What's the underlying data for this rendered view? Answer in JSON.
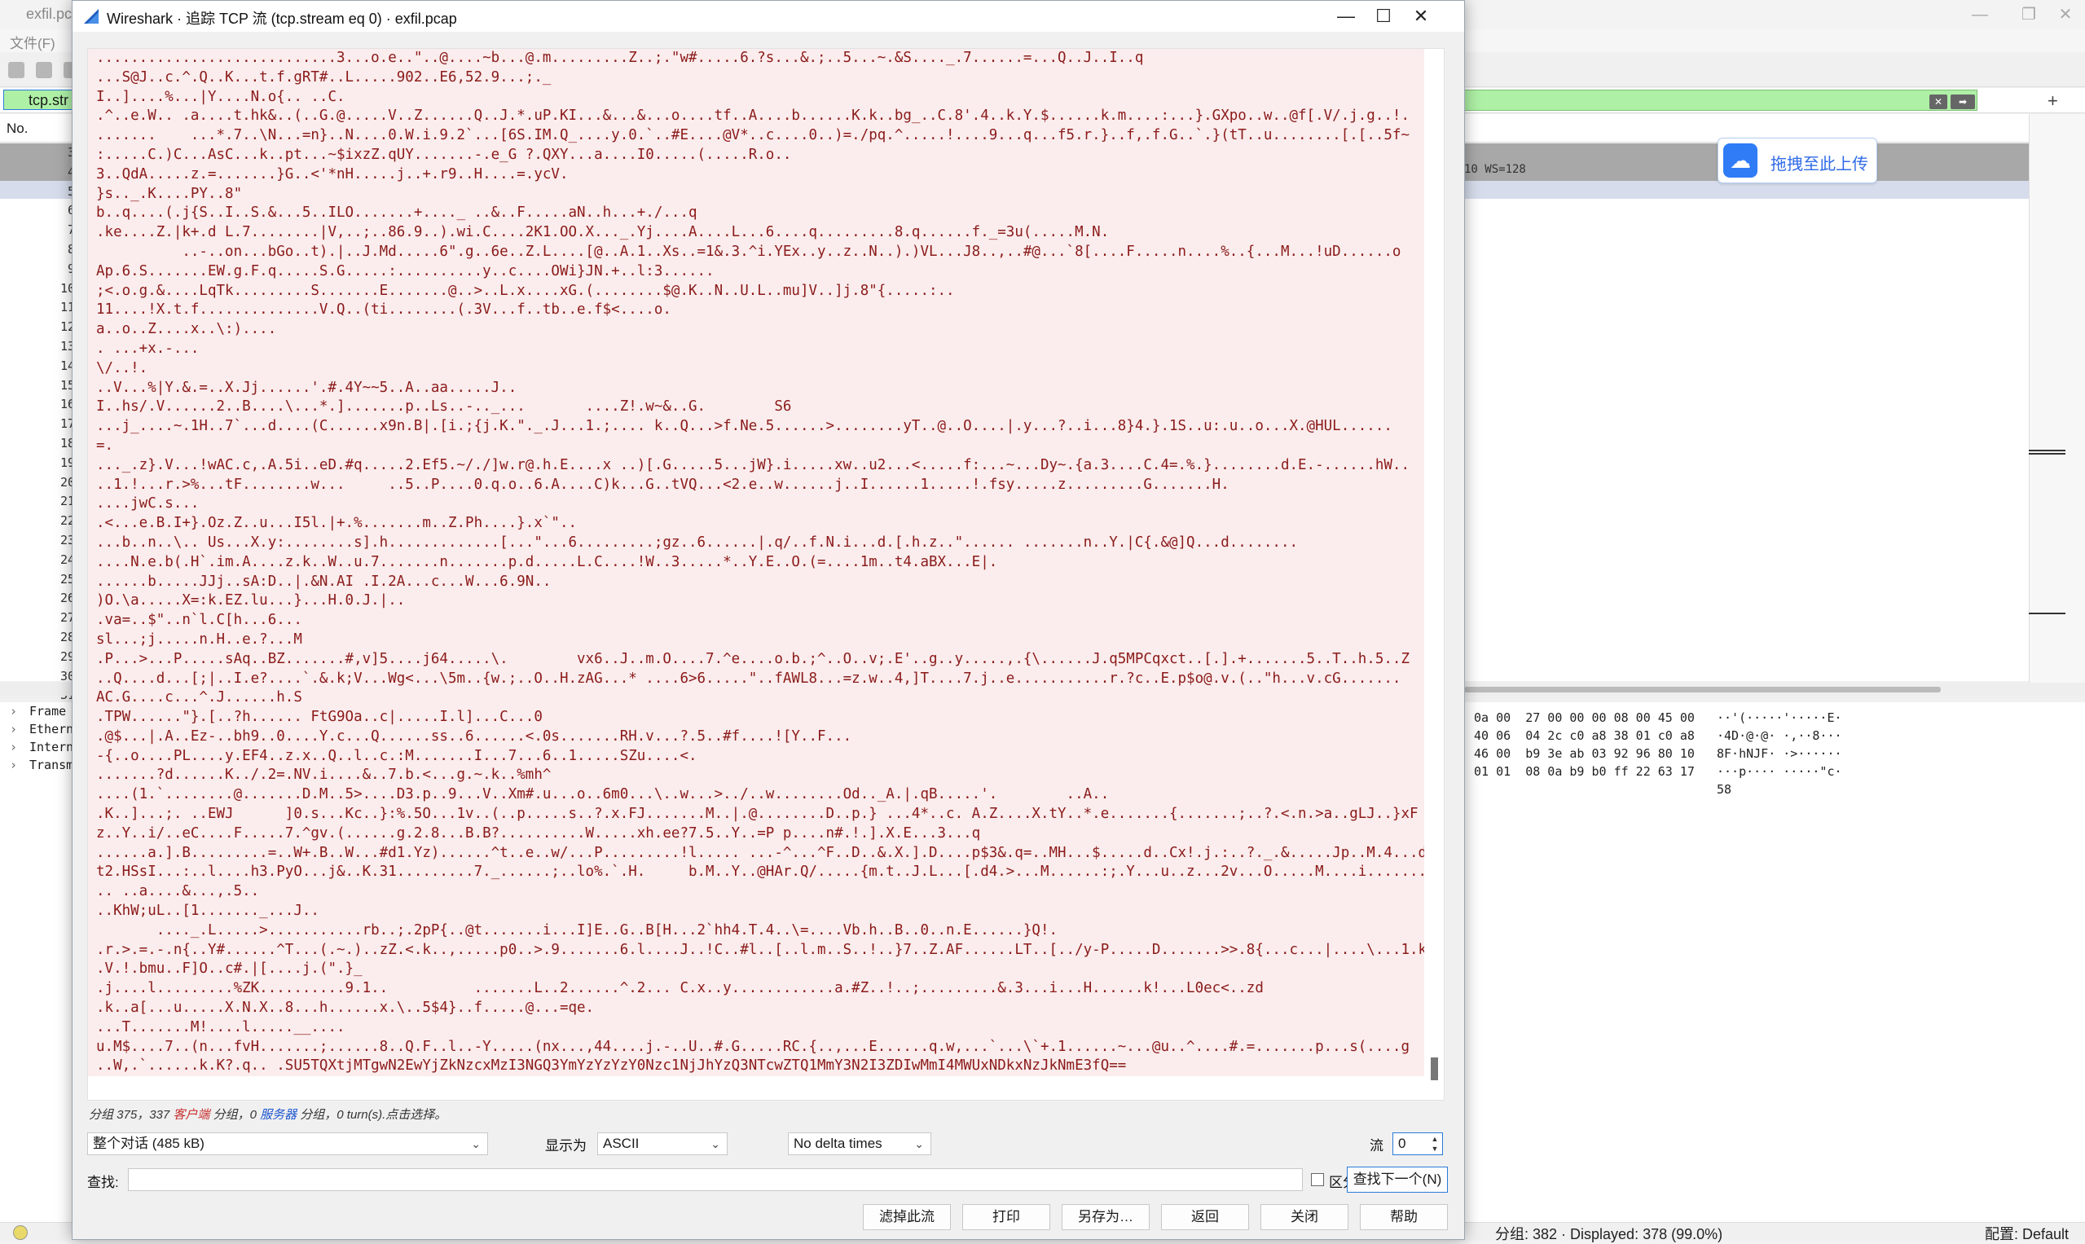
{
  "background_window": {
    "title": "exfil.pca",
    "menu_file": "文件(F)",
    "filter_text": "tcp.str",
    "col_no": "No.",
    "row_numbers": [
      "3",
      "4",
      "5",
      "6",
      "7",
      "8",
      "9",
      "10",
      "11",
      "12",
      "13",
      "14",
      "15",
      "16",
      "17",
      "18",
      "19",
      "20",
      "21",
      "22",
      "23",
      "24",
      "25",
      "26",
      "27",
      "28",
      "29",
      "30",
      "31"
    ],
    "row_info": "10 WS=128",
    "details": [
      "Frame",
      "Ethern",
      "Intern",
      "Transm"
    ],
    "bytes_hex": "0a 00  27 00 00 00 08 00 45 00\n40 06  04 2c c0 a8 38 01 c0 a8\n46 00  b9 3e ab 03 92 96 80 10\n01 01  08 0a b9 b0 ff 22 63 17",
    "bytes_ascii": "··'(·····'·····E·\n·4D·@·@· ·,··8···\n8F·hNJF· ·>······\n···p···· ·····\"c·\n58",
    "status_text": "分组: 382 · Displayed: 378 (99.0%)",
    "status_profile": "配置: Default",
    "upload_label": "拖拽至此上传"
  },
  "dialog": {
    "title": "Wireshark · 追踪 TCP 流 (tcp.stream eq 0) · exfil.pcap",
    "stream_lines": [
      "............................3...o.e..\"..@....~b...@.m.........Z..;.\"w#.....6.?s...&.;..5...~.&S...._.7......=...Q..J..I..q",
      "...S@J..c.^.Q..K...t.f.gRT#..L.....902..E6,52.9...;._",
      "I..]....%...|Y....N.o{.. ..C.",
      ".^..e.W.. .a....t.hk&..(..G.@.....V..Z......Q..J.*.uP.KI...&...&...o....tf..A....b......K.k..bg_..C.8'.4..k.Y.$......k.m....:...}.GXpo..w..@f[.V/.j.g..!.",
      ".......    ...*.7..\\N...=n}..N....0.W.i.9.2`...[6S.IM.Q_....y.0.`..#E....@V*..c....0..)=./pq.^.....!....9...q...f5.r.}..f,.f.G..`.}(tT..u........[.[..5f~",
      ":.....C.)C...AsC...k..pt...~$ixzZ.qUY.......-.e_G ?.QXY...a....I0.....(.....R.o..",
      "3..QdA.....z.=.......}G..<'*nH.....j..+.r9..H....=.ycV.",
      "}s.._.K....PY..8\"",
      "b..q....(.j{S..I..S.&...5..ILO.......+...._ ..&..F.....aN..h...+./...q",
      ".ke....Z.|k+.d L.7........|V,..;..86.9..).wi.C....2K1.OO.X..._.Yj....A....L...6....q.........8.q......f._=3u(.....M.N.",
      "          ..-..on...bGo..t).|..J.Md.....6\".g..6e..Z.L....[@..A.1..Xs..=1&.3.^i.YEx..y..z..N..).)VL...J8..,..#@...`8[....F.....n....%..{...M...!uD......o",
      "Ap.6.S.......EW.g.F.q.....S.G.....:..........y..c....OWi}JN.+..l:3......",
      ";<.o.g.&....LqTk.........S.......E.......@..>..L.x....xG.(........$@.K..N..U.L..mu]V..]j.8\"{.....:..",
      "11....!X.t.f..............V.Q..(ti........(.3V...f..tb..e.f$<....o.",
      "a..o..Z....x..\\:)....",
      ". ...+x.-...",
      "\\/..!.",
      "..V...%|Y.&.=..X.Jj......'.#.4Y~~5..A..aa.....J..",
      "I..hs/.V......2..B....\\...*.].......p..Ls..-.._...       ....Z!.w~&..G.        S6",
      "...j_....~.1H..7`...d....(C......x9n.B|.[i.;{j.K.\"._.J...1.;.... k..Q...>f.Ne.5......>........yT..@..O....|.y...?..i...8}4.}.1S..u:.u..o...X.@HUL......",
      "=.",
      "..._.z}.V...!wAC.c,.A.5i..eD.#q.....2.Ef5.~/./]w.r@.h.E....x ..)[.G.....5...jW}.i.....xw..u2...<.....f:...~...Dy~.{a.3....C.4=.%.}........d.E.-......hW..",
      "..1.!...r.>%...tF........w...     ..5..P....0.q.o..6.A....C)k...G..tVQ...<2.e..w......j..I......1.....!.fsy.....z.........G.......H.",
      "....jwC.s...",
      ".<...e.B.I+}.Oz.Z..u...I5l.|+.%.......m..Z.Ph....}.x`\"..",
      "...b..n..\\.. Us...X.y:........s].h.............[...\"...6.........;gz..6......|.q/..f.N.i...d.[.h.z..\"...... .......n..Y.|C{.&@]Q...d........",
      "....N.e.b(.H`.im.A....z.k..W..u.7.......n.......p.d.....L.C....!W..3.....*..Y.E..O.(=....1m..t4.aBX...E|.",
      "......b.....JJj..sA:D..|.&N.AI .I.2A...c...W...6.9N..",
      ")O.\\a.....X=:k.EZ.lu...}...H.0.J.|..",
      ".va=..$\"..n`l.C[h...6...",
      "sl...;j.....n.H..e.?...M",
      ".P...>...P.....sAq..BZ.......#,v]5....j64.....\\.        vx6..J..m.O....7.^e....o.b.;^..O..v;.E'..g..y.....,.{\\......J.q5MPCqxct..[.].+.......5..T..h.5..Z",
      "..Q....d...[;|..I.e?....`.&.k;V...Wg<...\\5m..{w.;..O..H.zAG...* ....6>6.....\"..fAWL8...=z.w..4,]T....7.j..e...........r.?c..E.p$o@.v.(..\"h...v.cG.......",
      "AC.G....c...^.J......h.S",
      ".TPW......\"}.[..?h...... FtG9Oa..c|.....I.l]...C...0",
      ".@$...|.A..Ez-..bh9..0....Y.c...Q......ss..6......<.0s.......RH.v...?.5..#f....![Y..F...",
      "-{..o....PL....y.EF4..z.x..Q..l..c.:M.......I...7...6..1.....SZu....<.",
      ".......?d......K../.2=.NV.i....&..7.b.<...g.~.k..%mh^",
      "....(1.`........@.......D.M..5>....D3.p..9...V..Xm#.u...o..6m0...\\..w...>../..w........Od.._A.|.qB.....'.        ..A..",
      ".K..]...;. ..EWJ      ]0.s...Kc..}:%.5O...1v..(..p.....s..?.x.FJ.......M..|.@........D..p.} ...4*..c. A.Z....X.tY..*.e.......{.......;..?.<.n.>a..gLJ..}xF",
      "z..Y..i/..eC....F.....7.^gv.(......g.2.8...B.B?..........W.....xh.ee?7.5..Y..=P p....n#.!.].X.E...3...q",
      "......a.].B.........=..W+.B..W...#d1.Yz)......^t..e..w/...P.........!l..... ...-^...^F..D..&.X.].D....p$3&.q=..MH...$.....d..Cx!.j.:..?._.&.....Jp..M.4...d",
      "t2.HSsI...:..l....h3.PyO...j&..K.31.........7._......;..lo%.`.H.     b.M..Y..@HAr.Q/.....{m.t..J.L...[.d4.>...M......:;.Y...u..z...2v...O.....M....i........",
      ".. ..a....&...,.5..",
      "..KhW;uL..[1......._...J..",
      "       ...._.L.....>...........rb..;.2pP{..@t.......i...I]E..G..B[H...2`hh4.T.4..\\=....Vb.h..B..0..n.E......}Q!.",
      ".r.>.=.-.n{..Y#......^T...(.~.)..zZ.<.k..,.....p0..>.9.......6.l....J..!C..#l..[..l.m..S..!..}7..Z.AF......LT..[../y-P.....D.......>>.8{...c...|....\\...1.k",
      ".V.!.bmu..F]O..c#.|[....j.(\".}_",
      ".j....l.........%ZK..........9.1..          .......L..2......^.2... C.x..y............a.#Z..!..;.........&.3...i...H......k!...L0ec<..zd",
      ".k..a[...u.....X.N.X..8...h......x.\\..5$4}..f.....@...=qe.",
      "...T.......M!....l.....__....",
      "u.M$....7..(n...fvH.......;......8..Q.F..l..-Y.....(nx...,44....j.-..U..#.G.....RC.{..,...E......q.w,...`...\\`+.1......~...@u..^....#.=.......p...s(....g",
      "..W,.`......k.K?.q.. .SU5TQXtjMTgwN2EwYjZkNzcxMzI3NGQ3YmYzYzYzY0Nzc1NjJhYzQ3NTcwZTQ1MmY3N2I3ZDIwMmI4MWUxNDkxNzJkNmE3fQ=="
    ],
    "summary": {
      "prefix": "分组 375，337 ",
      "client_link": "客户端",
      "middle": " 分组，0 ",
      "server_link": "服务器",
      "suffix": " 分组，0 turn(s).点击选择。"
    },
    "conversation_select": "整个对话 (485 kB)",
    "show_as_label": "显示为",
    "show_as_value": "ASCII",
    "delta_select": "No delta times",
    "stream_label": "流",
    "stream_value": "0",
    "find_label": "查找:",
    "find_value": "",
    "case_label": "区分大小写",
    "find_next": "查找下一个(N)",
    "buttons": {
      "filter_out": "滤掉此流",
      "print": "打印",
      "save_as": "另存为…",
      "back": "返回",
      "close": "关闭",
      "help": "帮助"
    }
  }
}
